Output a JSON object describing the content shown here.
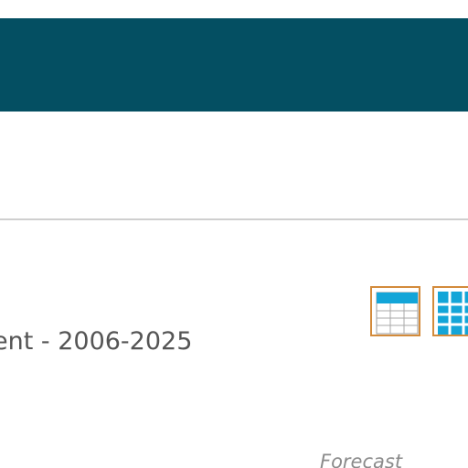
{
  "header": {
    "banner_color": "#044f62"
  },
  "section": {
    "title": "ent - 2006-2025",
    "divider_color": "#cfcfcf"
  },
  "view_toggles": [
    {
      "name": "table-view",
      "icon": "table-icon"
    },
    {
      "name": "grid-view",
      "icon": "grid-icon"
    }
  ],
  "accent_colors": {
    "button_border": "#d38b3b",
    "icon_fill": "#13a5d8"
  },
  "chart": {
    "forecast_label": "Forecast"
  }
}
